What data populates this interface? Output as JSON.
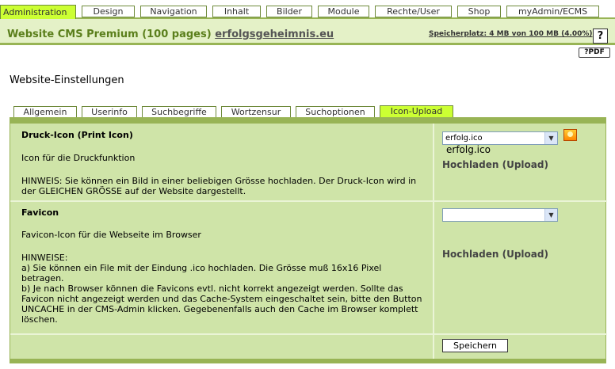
{
  "top_tabs": [
    {
      "label": "Administration",
      "active": true
    },
    {
      "label": "Design"
    },
    {
      "label": "Navigation"
    },
    {
      "label": "Inhalt"
    },
    {
      "label": "Bilder"
    },
    {
      "label": "Module"
    },
    {
      "label": "Rechte/User"
    },
    {
      "label": "Shop"
    },
    {
      "label": "myAdmin/ECMS"
    }
  ],
  "header": {
    "site_title": "Website CMS Premium (100 pages)",
    "domain": "erfolgsgeheimnis.eu",
    "storage": "Speicherplatz: 4 MB von 100 MB (4.00%)",
    "help_label": "?",
    "pdf_label": "?PDF"
  },
  "page_title": "Website-Einstellungen",
  "sub_tabs": [
    {
      "label": "Allgemein"
    },
    {
      "label": "Userinfo"
    },
    {
      "label": "Suchbegriffe"
    },
    {
      "label": "Wortzensur"
    },
    {
      "label": "Suchoptionen"
    },
    {
      "label": "Icon-Upload",
      "active": true
    }
  ],
  "print_icon": {
    "title": "Druck-Icon (Print Icon)",
    "description": "Icon für die Druckfunktion",
    "note": "HINWEIS: Sie können ein Bild in einer beliebigen Grösse hochladen. Der Druck-Icon wird in der GLEICHEN GRÖSSE auf der Website dargestellt.",
    "select_value": "erfolg.ico",
    "file_name": "erfolg.ico",
    "upload_label": "Hochladen (Upload)",
    "icon": "print-sun-icon"
  },
  "favicon": {
    "title": "Favicon",
    "description": "Favicon-Icon für die Webseite im Browser",
    "notes": [
      "HINWEISE:",
      "a) Sie können ein File mit der Eindung .ico hochladen. Die Grösse muß 16x16 Pixel betragen.",
      "b) Je nach Browser können die Favicons evtl. nicht korrekt angezeigt werden. Sollte das Favicon nicht angezeigt werden und das Cache-System eingeschaltet sein, bitte den Button UNCACHE in der CMS-Admin klicken. Gegebenenfalls auch den Cache im Browser komplett löschen."
    ],
    "select_value": "",
    "upload_label": "Hochladen (Upload)"
  },
  "save_label": "Speichern",
  "colors": {
    "accent": "#ccff33",
    "panel": "#cfe4a8",
    "border": "#98b455",
    "title_green": "#5b7f1c"
  }
}
